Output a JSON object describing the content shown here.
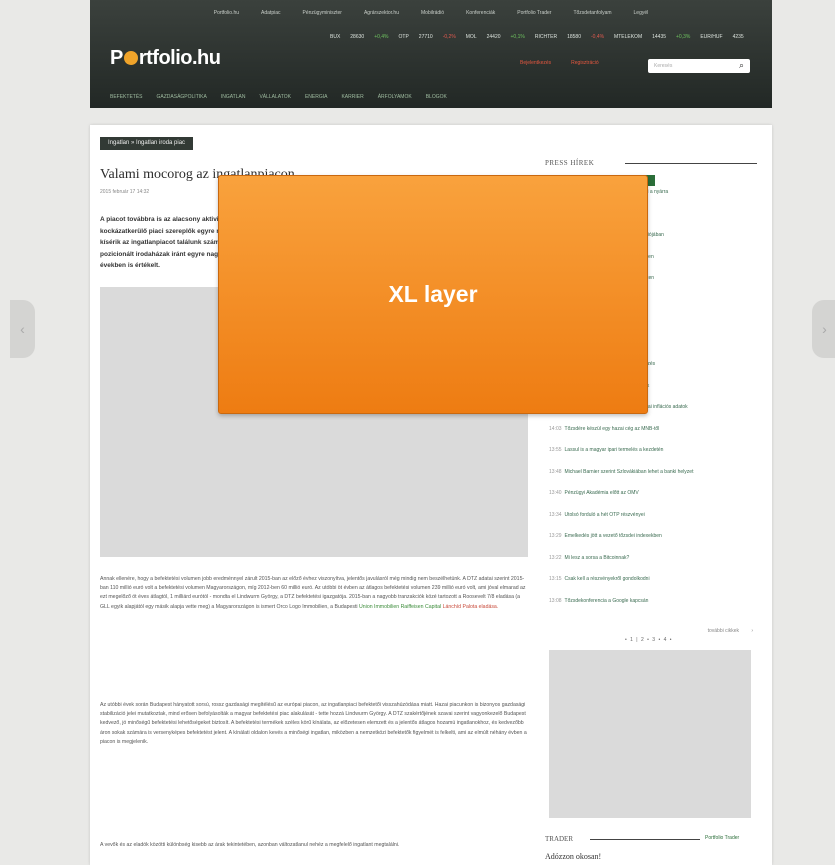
{
  "header": {
    "utility_links": [
      "Portfolio.hu",
      "Adatpiac",
      "Pénzügyminiszter",
      "Agrárszektor.hu",
      "Mobilrádió",
      "Konferenciák",
      "Portfolio Trader",
      "Tőzsdetanfolyam",
      "Legyél"
    ],
    "ticker": [
      {
        "name": "BUX",
        "value": "28630",
        "change": "+0,4%",
        "dir": "p"
      },
      {
        "name": "OTP",
        "value": "27710",
        "change": "-0,2%",
        "dir": "n"
      },
      {
        "name": "MOL",
        "value": "24420",
        "change": "+0,1%",
        "dir": "p"
      },
      {
        "name": "RICHTER",
        "value": "18580",
        "change": "-0,4%",
        "dir": "n"
      },
      {
        "name": "MTELEKOM",
        "value": "14435",
        "change": "+0,3%",
        "dir": "p"
      },
      {
        "name": "EUR/HUF",
        "value": "4235",
        "change": "",
        "dir": "p"
      }
    ],
    "logo": {
      "prefix": "P",
      "suffix": "rtfolio.hu"
    },
    "red_links": [
      "Bejelentkezés",
      "Regisztráció"
    ],
    "search": {
      "placeholder": "Keresés"
    },
    "nav": [
      "BEFEKTETÉS",
      "GAZDASÁGPOLITIKA",
      "INGATLAN",
      "VÁLLALATOK",
      "ENERGIA",
      "KARRIER",
      "ÁRFOLYAMOK",
      "BLOGOK"
    ]
  },
  "article": {
    "breadcrumb": "Ingatlan » Ingatlan iroda piac",
    "title": "Valami mocorog az ingatlanpiacon",
    "date": "2015 február 17 14:32",
    "lead": "A piacot továbbra is az alacsony aktivitás jellemzi, de a kockázatkerülő piaci szereplők egyre nagyobb figyelemmel kísérik az ingatlanpiacot találunk számukra. A megfelelően pozicionált irodaházak iránt egyre nagyobb a kereslet, utóbbi években is értékelt.",
    "p1_text": "Annak ellenére, hogy a befektetési volumen jobb eredménnyel zárult 2015-ban az előző évhez viszonyítva, jelentős javulásról még mindig nem beszélhetünk. A DTZ adatai szerint 2015-ban 110 millió euró volt a befektetési volumen Magyarországon, míg 2012-ben 60 millió euró. Az utóbbi öt évben az átlagos befektetési volumen 239 millió euró volt, ami jóval elmarad az ezt megelőző öt éves átlagtól, 1 milliárd eurótól - mondta el Lindwurm György, a DTZ befektetési igazgatója. 2015-ban a nagyobb tranzakciók közé tartozott a Roosevelt 7/8 eladása (a GLL egyik alapjától egy másik alapja vette meg) a Magyarországon is ismert Orco Logo Immobilien, a Budapesti",
    "p1_link": "Union Immobilien Raiffeisen Capital",
    "p1_red": "Lánchíd Palota eladása.",
    "p2": "Az utóbbi évek során Budapest hányatott sorsú, rossz gazdasági megítélésű az európai piacon, az ingatlanpiaci befektetői visszahúzódása miatt. Hazai piacunkon is bizonyos gazdasági stabilizáció jelei mutatkoztak, mind erősen befolyásolták a magyar befektetési piac alakulását - tette hozzá Lindwurm György. A DTZ szakértőjének szavai szerint vagyonkezelő Budapest kedvező, jó minőségű befektetési lehetőségeket biztosít. A befektetési termékek széles körű kínálata, az előzetesen elemzett és a jelentős átlagos hozamú ingatlanokhoz, és kedvezőbb áron sokak számára is versenyképes befektetést jelent. A kínálati oldalon kevés a minőségi ingatlan, miközben a nemzetközi befektetők figyelmét is felkelti, ami az elmúlt néhány évben a piacon is megjelenik.",
    "p3": "A vevők és az eladók közötti különbség kisebb az árak tekintetében, azonban változatlanul nehéz a megfelelő ingatlant megtalálni."
  },
  "sidebar": {
    "press_title": "PRESS HÍREK",
    "news": [
      {
        "time": "15:10",
        "text": "Kevés embernek van pénze félrerakni a nyárra"
      },
      {
        "time": "15:04",
        "text": "Fontos változások a befektetésekben"
      },
      {
        "time": "14:59",
        "text": "Hazai részvények a Templeton portfóliójában"
      },
      {
        "time": "14:52",
        "text": "Mi a helyzet a hitelezéssel az idei évben"
      },
      {
        "time": "14:45",
        "text": "Ezek a cégek kaptak új sztorikat a héten"
      },
      {
        "time": "14:38",
        "text": "Mi lesz a forinttal?"
      },
      {
        "time": "14:31",
        "text": "Merre tart a FED? Mire figyeljünk?"
      },
      {
        "time": "14:27",
        "text": "A jegybank döntése a héten"
      },
      {
        "time": "14:22",
        "text": "Befektetési alapok a válságból - elemzés"
      },
      {
        "time": "14:18",
        "text": "Az euró árfolyama és a régiós devizák"
      },
      {
        "time": "14:12",
        "text": "Jöhet még alapkamat-vágás ha a hazai inflációs adatok"
      },
      {
        "time": "14:03",
        "text": "Tőzsdére készül egy hazai cég az MNB-től"
      },
      {
        "time": "13:55",
        "text": "Lassul is a magyar ipari termelés a kezdetén"
      },
      {
        "time": "13:48",
        "text": "Michael Barnier szerint Szlovákiában lehet a banki helyzet"
      },
      {
        "time": "13:40",
        "text": "Pénzügyi Akadémia előtt az OMV"
      },
      {
        "time": "13:34",
        "text": "Utolsó forduló a hét OTP részvényei"
      },
      {
        "time": "13:29",
        "text": "Emelkedés jött a vezető tőzsdei indexekben"
      },
      {
        "time": "13:22",
        "text": "Mi lesz a sorsa a Bitcoinnak?"
      },
      {
        "time": "13:15",
        "text": "Csak kell a részvényekről gondolkodni"
      },
      {
        "time": "13:08",
        "text": "Tőzsdekonferencia a Google kapcsán"
      }
    ],
    "more_label": "további cikkek",
    "pager_dots": "• 1 | 2 • 3 • 4 •",
    "trader_title": "TRADER",
    "trader_logo": "Portfolio Trader",
    "trader_headline": "Adózzon okosan!"
  },
  "overlay": {
    "label": "XL layer"
  },
  "arrows": {
    "left": "‹",
    "right": "›"
  }
}
